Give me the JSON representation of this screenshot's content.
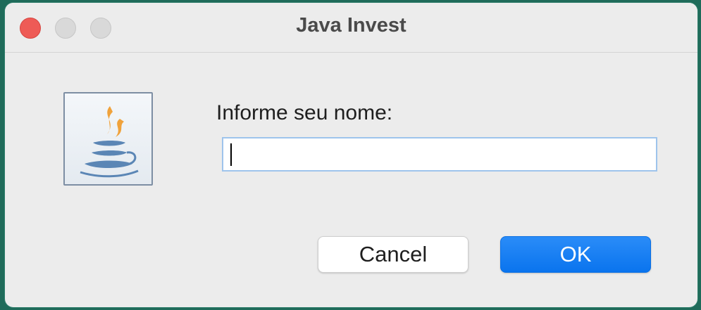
{
  "window": {
    "title": "Java Invest"
  },
  "dialog": {
    "icon": "java-icon",
    "prompt": "Informe seu nome:",
    "input_value": ""
  },
  "buttons": {
    "cancel_label": "Cancel",
    "ok_label": "OK"
  },
  "colors": {
    "accent": "#0a74ee",
    "close_button": "#ee5b56",
    "window_background": "#ececec"
  }
}
